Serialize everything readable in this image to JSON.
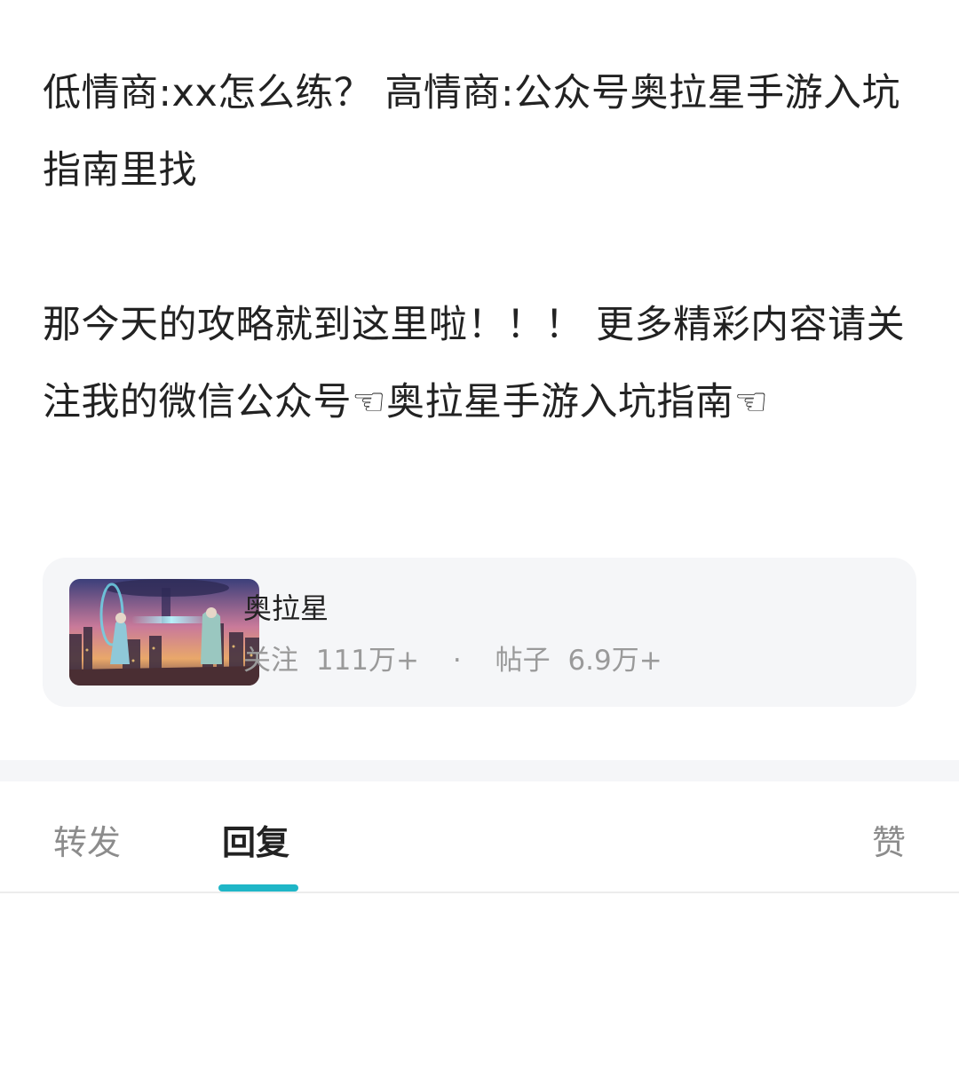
{
  "post": {
    "paragraph1": "低情商:xx怎么练？ 高情商:公众号奥拉星手游入坑指南里找",
    "paragraph2": "那今天的攻略就到这里啦！！！ 更多精彩内容请关注我的微信公众号☜奥拉星手游入坑指南☜"
  },
  "circle": {
    "name": "奥拉星",
    "followers_label": "关注",
    "followers_value": "111万+",
    "separator": "·",
    "posts_label": "帖子",
    "posts_value": "6.9万+"
  },
  "tabs": [
    {
      "label": "转发",
      "active": false
    },
    {
      "label": "回复",
      "active": true
    },
    {
      "label": "赞",
      "active": false
    }
  ],
  "colors": {
    "accent": "#1fb6c7",
    "card_bg": "#f5f6f8",
    "muted_text": "#9a9a9a"
  },
  "icons": {
    "circle_thumbnail": "game-banner-image"
  }
}
